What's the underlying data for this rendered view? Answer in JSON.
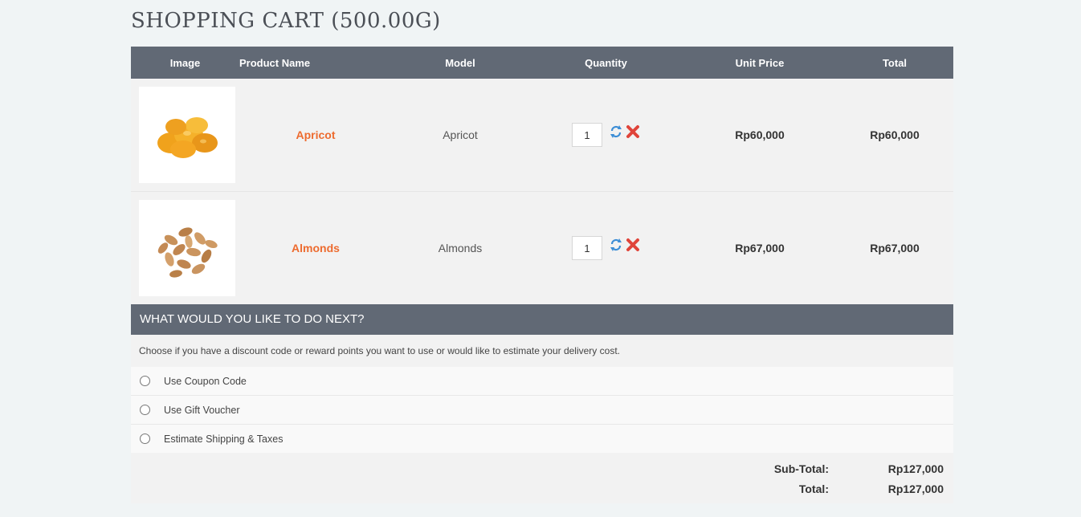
{
  "page": {
    "title": "SHOPPING CART  (500.00G)"
  },
  "table": {
    "headers": [
      "Image",
      "Product Name",
      "Model",
      "Quantity",
      "Unit Price",
      "Total"
    ]
  },
  "items": [
    {
      "name": "Apricot",
      "model": "Apricot",
      "qty": "1",
      "unit_price": "Rp60,000",
      "total": "Rp60,000"
    },
    {
      "name": "Almonds",
      "model": "Almonds",
      "qty": "1",
      "unit_price": "Rp67,000",
      "total": "Rp67,000"
    }
  ],
  "next": {
    "heading": "WHAT WOULD YOU LIKE TO DO NEXT?",
    "description": "Choose if you have a discount code or reward points you want to use or would like to estimate your delivery cost.",
    "options": [
      "Use Coupon Code",
      "Use Gift Voucher",
      "Estimate Shipping & Taxes"
    ]
  },
  "totals": {
    "subtotal_label": "Sub-Total:",
    "subtotal_value": "Rp127,000",
    "total_label": "Total:",
    "total_value": "Rp127,000"
  },
  "icons": {
    "update": "refresh-icon",
    "remove": "remove-icon"
  },
  "colors": {
    "header_bg": "#616975",
    "product_link": "#ed6b2f",
    "remove_icon": "#e0443a",
    "update_icon": "#3d8ed6"
  }
}
